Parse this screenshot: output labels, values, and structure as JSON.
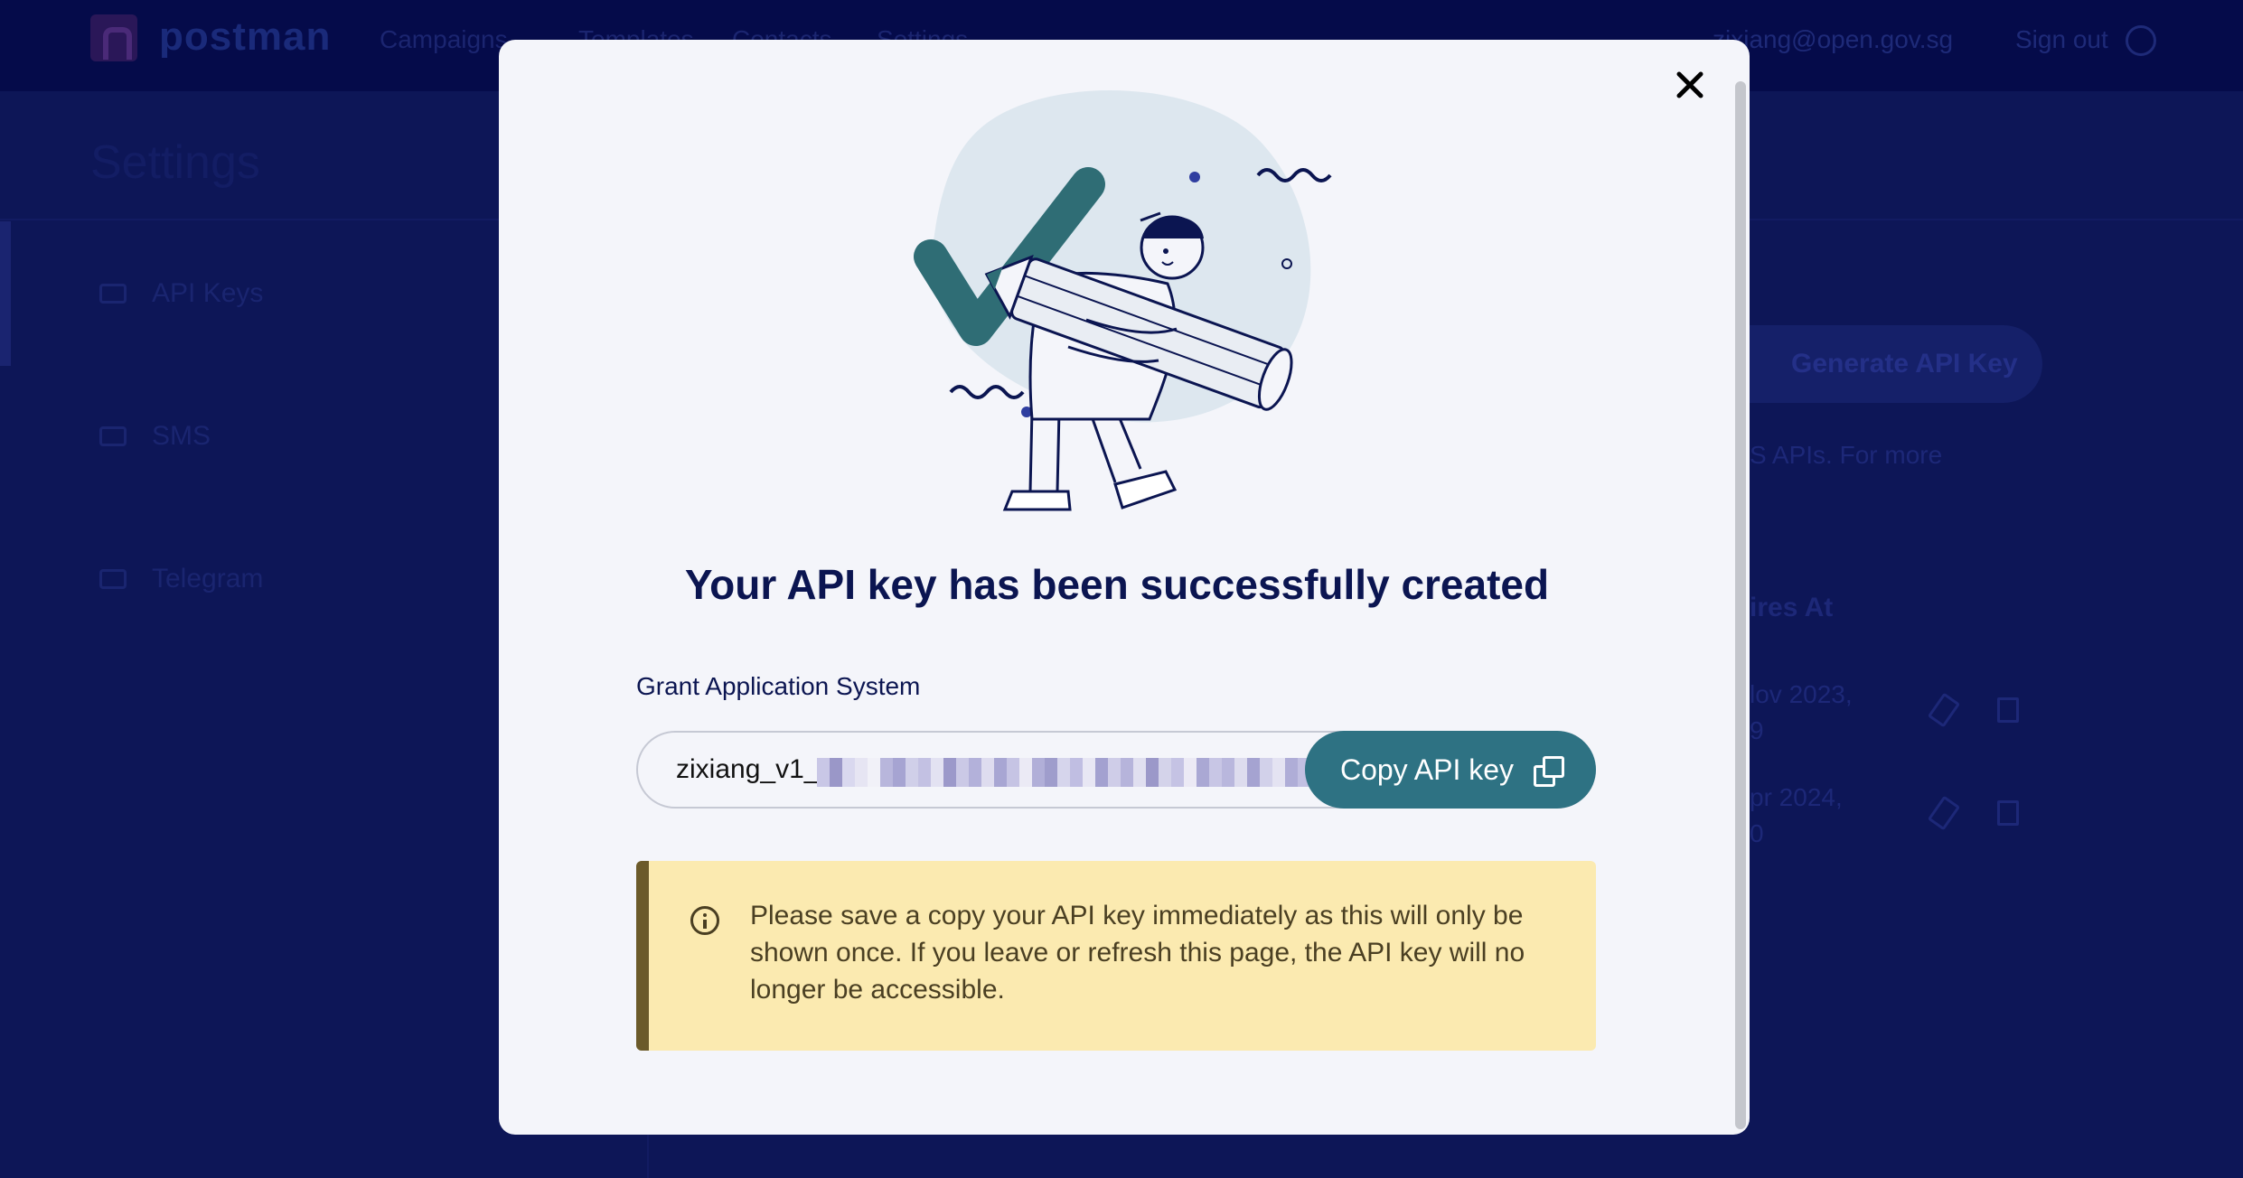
{
  "background": {
    "brand": "postman",
    "nav_items": [
      "Campaigns",
      "Templates",
      "Contacts",
      "Settings"
    ],
    "user_email": "zixiang@open.gov.sg",
    "sign_out_label": "Sign out",
    "page_title": "Settings",
    "sidebar_items": [
      {
        "label": "API Keys",
        "icon": "key-icon"
      },
      {
        "label": "SMS",
        "icon": "chat-icon"
      },
      {
        "label": "Telegram",
        "icon": "send-icon"
      }
    ],
    "generate_button_label": "Generate API Key",
    "desc_fragment": "S APIs. For more",
    "table_header_fragment": "ires At",
    "rows": [
      {
        "line1": "lov 2023,",
        "line2": "9"
      },
      {
        "line1": "pr 2024,",
        "line2": "0"
      }
    ]
  },
  "modal": {
    "close_icon": "close-icon",
    "illustration": "success-checkmark-illustration",
    "title": "Your API key has been successfully created",
    "key_label": "Grant Application System",
    "key_prefix": "zixiang_v1_",
    "copy_button_label": "Copy API key",
    "copy_icon": "copy-icon",
    "warning_icon": "info-icon",
    "warning_text": "Please save a copy your API key immediately as this will only be shown once. If you leave or refresh this page, the API key will no longer be accessible."
  },
  "colors": {
    "overlay": "#0b1256",
    "primary": "#2e7283",
    "warning_bg": "#fbeab0",
    "warning_accent": "#6b5a2a",
    "text_dark": "#0b1551"
  }
}
